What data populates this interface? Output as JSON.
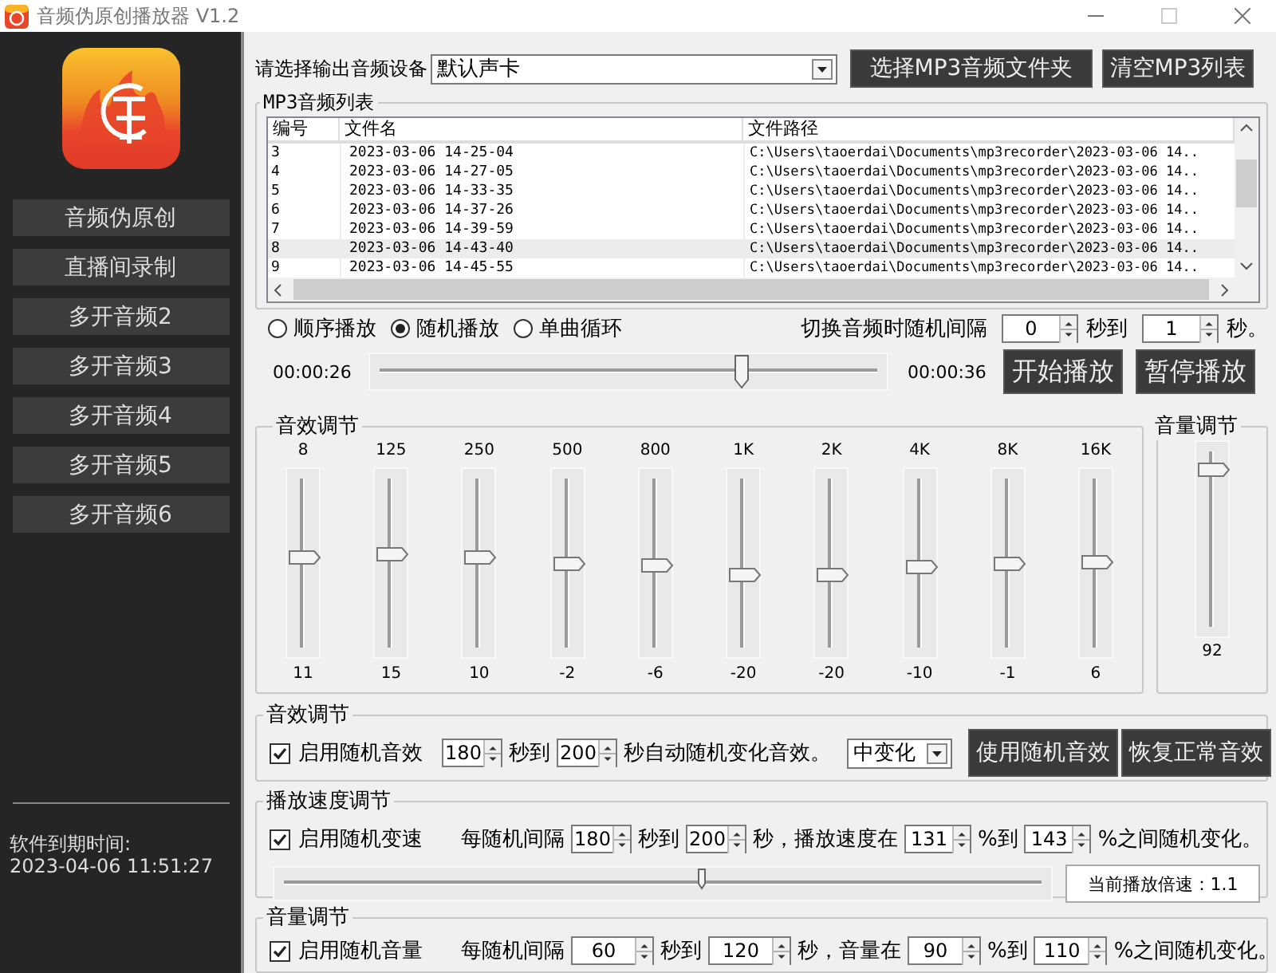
{
  "window": {
    "title": "音频伪原创播放器 V1.2"
  },
  "sidebar": {
    "items": [
      {
        "label": "音频伪原创"
      },
      {
        "label": "直播间录制"
      },
      {
        "label": "多开音频2"
      },
      {
        "label": "多开音频3"
      },
      {
        "label": "多开音频4"
      },
      {
        "label": "多开音频5"
      },
      {
        "label": "多开音频6"
      }
    ],
    "expiry_label": "软件到期时间:",
    "expiry_time": "2023-04-06 11:51:27"
  },
  "device": {
    "label": "请选择输出音频设备",
    "value": "默认声卡"
  },
  "top_buttons": [
    "选择MP3音频文件夹",
    "清空MP3列表"
  ],
  "playlist": {
    "title": "MP3音频列表",
    "columns": [
      "编号",
      "文件名",
      "文件路径"
    ],
    "rows": [
      {
        "cells": [
          "3",
          "2023-03-06 14-25-04",
          "C:\\Users\\taoerdai\\Documents\\mp3recorder\\2023-03-06 14.."
        ],
        "selected": false
      },
      {
        "cells": [
          "4",
          "2023-03-06 14-27-05",
          "C:\\Users\\taoerdai\\Documents\\mp3recorder\\2023-03-06 14.."
        ],
        "selected": false
      },
      {
        "cells": [
          "5",
          "2023-03-06 14-33-35",
          "C:\\Users\\taoerdai\\Documents\\mp3recorder\\2023-03-06 14.."
        ],
        "selected": false
      },
      {
        "cells": [
          "6",
          "2023-03-06 14-37-26",
          "C:\\Users\\taoerdai\\Documents\\mp3recorder\\2023-03-06 14.."
        ],
        "selected": false
      },
      {
        "cells": [
          "7",
          "2023-03-06 14-39-59",
          "C:\\Users\\taoerdai\\Documents\\mp3recorder\\2023-03-06 14.."
        ],
        "selected": false
      },
      {
        "cells": [
          "8",
          "2023-03-06 14-43-40",
          "C:\\Users\\taoerdai\\Documents\\mp3recorder\\2023-03-06 14.."
        ],
        "selected": true
      },
      {
        "cells": [
          "9",
          "2023-03-06 14-45-55",
          "C:\\Users\\taoerdai\\Documents\\mp3recorder\\2023-03-06 14.."
        ],
        "selected": false
      }
    ]
  },
  "play_modes": [
    {
      "label": "顺序播放",
      "selected": false
    },
    {
      "label": "随机播放",
      "selected": true
    },
    {
      "label": "单曲循环",
      "selected": false
    }
  ],
  "switch_interval": {
    "label": "切换音频时随机间隔",
    "from": "0",
    "to_label": "秒到",
    "to": "1",
    "unit": "秒。"
  },
  "progress": {
    "elapsed": "00:00:26",
    "level": 0.72,
    "total": "00:00:36"
  },
  "play_buttons": [
    "开始播放",
    "暂停播放"
  ],
  "equalizer": {
    "title": "音效调节",
    "bands": [
      {
        "label": "8",
        "level": 0.52,
        "value": "11"
      },
      {
        "label": "125",
        "level": 0.54,
        "value": "15"
      },
      {
        "label": "250",
        "level": 0.52,
        "value": "10"
      },
      {
        "label": "500",
        "level": 0.48,
        "value": "-2"
      },
      {
        "label": "800",
        "level": 0.47,
        "value": "-6"
      },
      {
        "label": "1K",
        "level": 0.41,
        "value": "-20"
      },
      {
        "label": "2K",
        "level": 0.41,
        "value": "-20"
      },
      {
        "label": "4K",
        "level": 0.46,
        "value": "-10"
      },
      {
        "label": "8K",
        "level": 0.48,
        "value": "-1"
      },
      {
        "label": "16K",
        "level": 0.49,
        "value": "6"
      }
    ]
  },
  "volume": {
    "title": "音量调节",
    "level": 0.9,
    "value": "92"
  },
  "effects": {
    "title": "音效调节",
    "enable": {
      "label": "启用随机音效",
      "checked": true
    },
    "from": "180",
    "to_label": "秒到",
    "to": "200",
    "suffix": "秒自动随机变化音效。",
    "mode": "中变化",
    "buttons": [
      "使用随机音效",
      "恢复正常音效"
    ]
  },
  "speed": {
    "title": "播放速度调节",
    "enable": {
      "label": "启用随机变速",
      "checked": true
    },
    "prefix": "每随机间隔",
    "from": "180",
    "to_label": "秒到",
    "to": "200",
    "mid": "秒，播放速度在",
    "low": "131",
    "pct_to": "%到",
    "high": "143",
    "suffix": "%之间随机变化。",
    "level": 0.55,
    "current": "当前播放倍速：1.1"
  },
  "random_volume": {
    "title": "音量调节",
    "enable": {
      "label": "启用随机音量",
      "checked": true
    },
    "prefix": "每随机间隔",
    "from": "60",
    "to_label": "秒到",
    "to": "120",
    "mid": "秒，音量在",
    "low": "90",
    "pct_to": "%到",
    "high": "110",
    "suffix": "%之间随机变化。"
  }
}
